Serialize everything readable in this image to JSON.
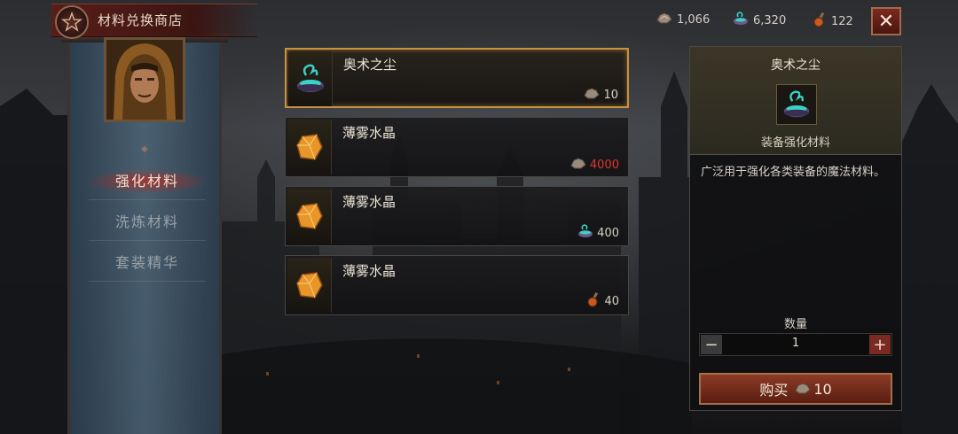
{
  "header": {
    "title": "材料兑换商店",
    "close_label": "✕"
  },
  "currencies": [
    {
      "icon": "ore-icon",
      "value": "1,066"
    },
    {
      "icon": "dust-bowl-icon",
      "value": "6,320"
    },
    {
      "icon": "potion-icon",
      "value": "122"
    }
  ],
  "sidebar": {
    "tabs": [
      {
        "label": "强化材料",
        "active": true
      },
      {
        "label": "洗炼材料",
        "active": false
      },
      {
        "label": "套装精华",
        "active": false
      }
    ]
  },
  "items": [
    {
      "name": "奥术之尘",
      "icon": "arcane-dust-icon",
      "price": "10",
      "price_icon": "ore-icon",
      "selected": true,
      "price_color": "#d6d0c6"
    },
    {
      "name": "薄雾水晶",
      "icon": "crystal-icon",
      "price": "4000",
      "price_icon": "ore-icon",
      "selected": false,
      "price_color": "#e0342a"
    },
    {
      "name": "薄雾水晶",
      "icon": "crystal-icon",
      "price": "400",
      "price_icon": "dust-bowl-icon",
      "selected": false,
      "price_color": "#d6d0c6"
    },
    {
      "name": "薄雾水晶",
      "icon": "crystal-icon",
      "price": "40",
      "price_icon": "potion-icon",
      "selected": false,
      "price_color": "#d6d0c6"
    }
  ],
  "detail": {
    "name": "奥术之尘",
    "type": "装备强化材料",
    "description": "广泛用于强化各类装备的魔法材料。",
    "quantity_label": "数量",
    "quantity": "1",
    "minus": "−",
    "plus": "+",
    "buy_label": "购买",
    "buy_price": "10"
  },
  "colors": {
    "accent_gold": "#c9913e",
    "title_red": "#5a1d18",
    "price_insufficient": "#e0342a",
    "buy_button": "#8c3a24"
  }
}
